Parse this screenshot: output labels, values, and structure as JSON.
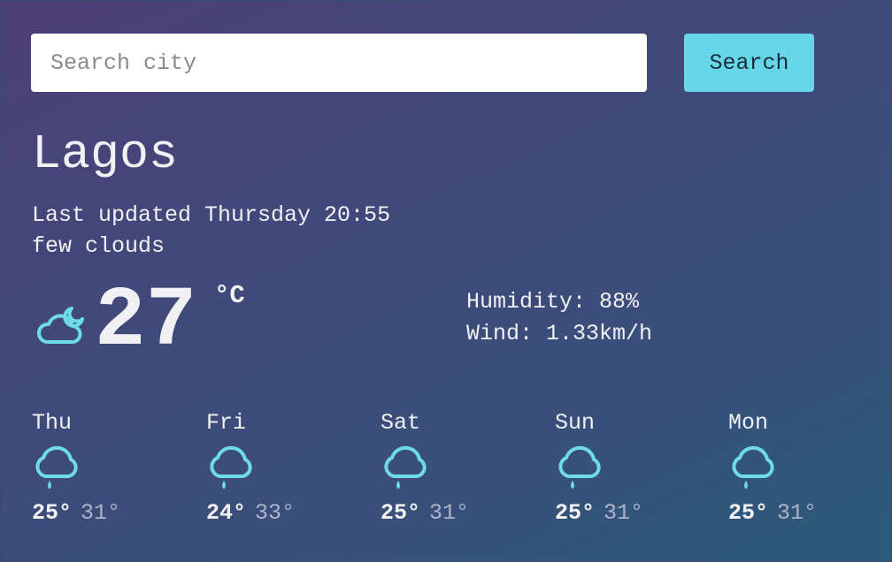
{
  "search": {
    "placeholder": "Search city",
    "button_label": "Search"
  },
  "current": {
    "city": "Lagos",
    "updated": "Last updated Thursday 20:55",
    "description": "few clouds",
    "icon": "cloud-moon-icon",
    "temperature": "27",
    "unit": "°C",
    "humidity": "Humidity: 88%",
    "wind": "Wind: 1.33km/h"
  },
  "forecast": [
    {
      "day": "Thu",
      "icon": "rain-cloud-icon",
      "min": "25°",
      "max": "31°"
    },
    {
      "day": "Fri",
      "icon": "rain-cloud-icon",
      "min": "24°",
      "max": "33°"
    },
    {
      "day": "Sat",
      "icon": "rain-cloud-icon",
      "min": "25°",
      "max": "31°"
    },
    {
      "day": "Sun",
      "icon": "rain-cloud-icon",
      "min": "25°",
      "max": "31°"
    },
    {
      "day": "Mon",
      "icon": "rain-cloud-icon",
      "min": "25°",
      "max": "31°"
    }
  ],
  "colors": {
    "accent": "#65d7e6",
    "icon": "#6fdbe7",
    "background_start": "#4d3f77",
    "background_end": "#2b5b7a"
  }
}
